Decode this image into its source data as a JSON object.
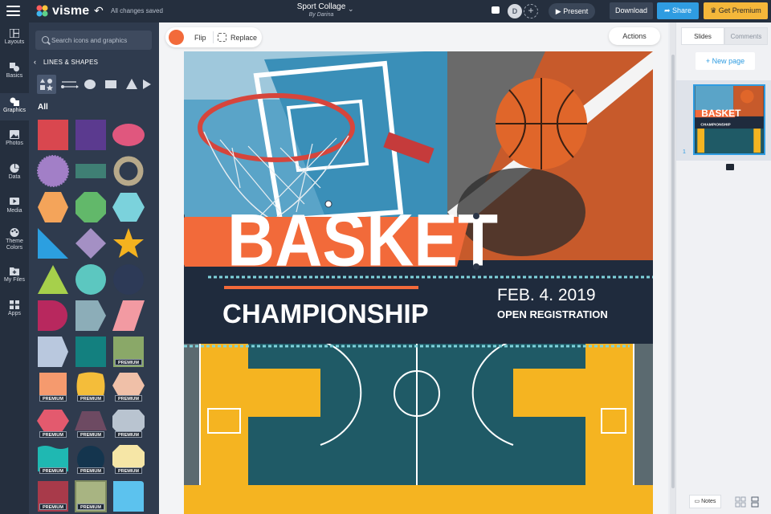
{
  "app": {
    "logo_text": "visme",
    "save_status": "All changes saved",
    "doc_title": "Sport Collage",
    "doc_author": "By Darina",
    "avatar_initial": "D",
    "add_collab": "+"
  },
  "header": {
    "present_label": "Present",
    "download_label": "Download",
    "share_label": "Share",
    "premium_label": "Get Premium"
  },
  "leftnav": {
    "items": [
      {
        "label": "Layouts",
        "icon": "layouts-icon"
      },
      {
        "label": "Basics",
        "icon": "basics-icon"
      },
      {
        "label": "Graphics",
        "icon": "graphics-icon"
      },
      {
        "label": "Photos",
        "icon": "photos-icon"
      },
      {
        "label": "Data",
        "icon": "data-icon"
      },
      {
        "label": "Media",
        "icon": "media-icon"
      },
      {
        "label": "Theme Colors",
        "icon": "palette-icon"
      },
      {
        "label": "My Files",
        "icon": "folder-icon"
      },
      {
        "label": "Apps",
        "icon": "apps-icon"
      }
    ]
  },
  "panel": {
    "search_placeholder": "Search icons and graphics",
    "section_title": "LINES & SHAPES",
    "all_label": "All",
    "premium_badge": "PREMIUM"
  },
  "toolbar": {
    "accent_color": "#f26a3a",
    "flip_label": "Flip",
    "replace_label": "Replace",
    "actions_label": "Actions"
  },
  "artboard": {
    "headline": "BASKET",
    "subhead": "CHAMPIONSHIP",
    "date": "FEB. 4. 2019",
    "cta": "OPEN REGISTRATION"
  },
  "rightpanel": {
    "slides_tab": "Slides",
    "comments_tab": "Comments",
    "new_page_label": "+ New page",
    "slide_number": "1",
    "notes_label": "Notes"
  },
  "colors": {
    "topbar": "#252f3e",
    "panel": "#2f3b4e",
    "share": "#2f9ce1",
    "premium": "#f4b73a",
    "orange": "#f26a3a",
    "navy": "#1f2b3d"
  }
}
